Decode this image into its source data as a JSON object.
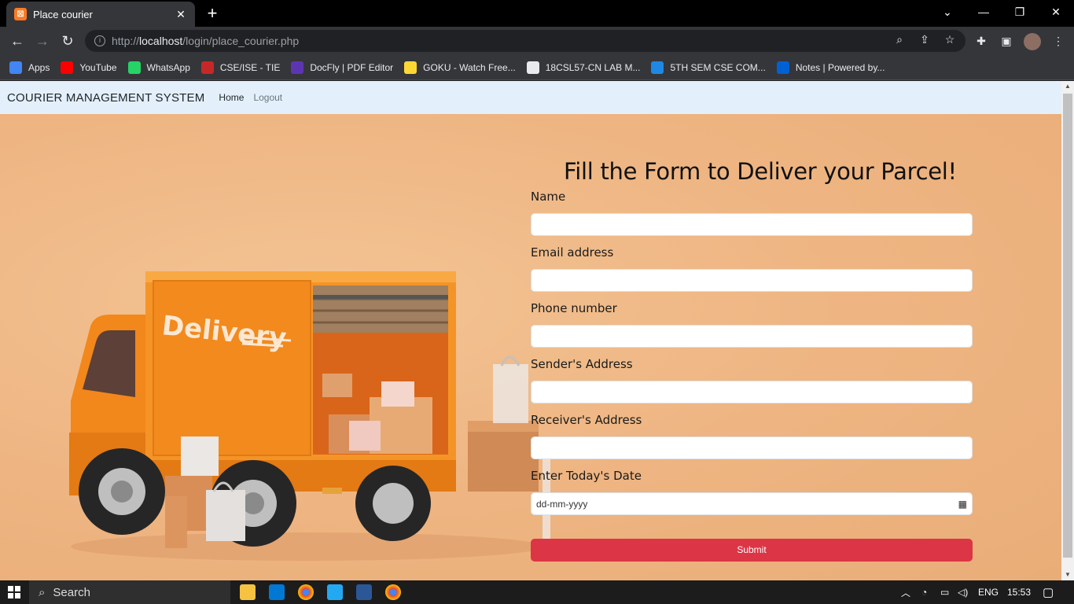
{
  "browser": {
    "tab_title": "Place courier",
    "url_prefix": "http://",
    "url_host": "localhost",
    "url_path": "/login/place_courier.php"
  },
  "bookmarks": [
    {
      "label": "Apps",
      "icon": "apps-grid-icon",
      "color": "#4285f4"
    },
    {
      "label": "YouTube",
      "icon": "youtube-icon",
      "color": "#ff0000"
    },
    {
      "label": "WhatsApp",
      "icon": "whatsapp-icon",
      "color": "#25d366"
    },
    {
      "label": "CSE/ISE - TIE",
      "icon": "bookmark-tie-icon",
      "color": "#c62828"
    },
    {
      "label": "DocFly | PDF Editor",
      "icon": "docfly-icon",
      "color": "#5e35b1"
    },
    {
      "label": "GOKU - Watch Free...",
      "icon": "goku-icon",
      "color": "#fdd835"
    },
    {
      "label": "18CSL57-CN LAB M...",
      "icon": "globe-icon",
      "color": "#e8eaed"
    },
    {
      "label": "5TH SEM CSE COM...",
      "icon": "crescent-icon",
      "color": "#1e88e5"
    },
    {
      "label": "Notes | Powered by...",
      "icon": "box-icon",
      "color": "#0061d5"
    }
  ],
  "navbar": {
    "brand": "COURIER MANAGEMENT SYSTEM",
    "links": [
      "Home",
      "Logout"
    ]
  },
  "form": {
    "title": "Fill the Form to Deliver your Parcel!",
    "fields": [
      {
        "label": "Name",
        "value": ""
      },
      {
        "label": "Email address",
        "value": ""
      },
      {
        "label": "Phone number",
        "value": ""
      },
      {
        "label": "Sender's Address",
        "value": ""
      },
      {
        "label": "Receiver's Address",
        "value": ""
      },
      {
        "label": "Enter Today's Date",
        "placeholder": "dd-mm-yyyy"
      }
    ],
    "submit_label": "Submit"
  },
  "illustration": {
    "truck_text": "Delivery"
  },
  "taskbar": {
    "search_label": "Search",
    "language": "ENG",
    "time": "15:53"
  },
  "colors": {
    "page_bg": "#f0b98a",
    "navbar_bg": "#e3f0fb",
    "submit_bg": "#dc3545",
    "truck_orange": "#f28a1e"
  }
}
